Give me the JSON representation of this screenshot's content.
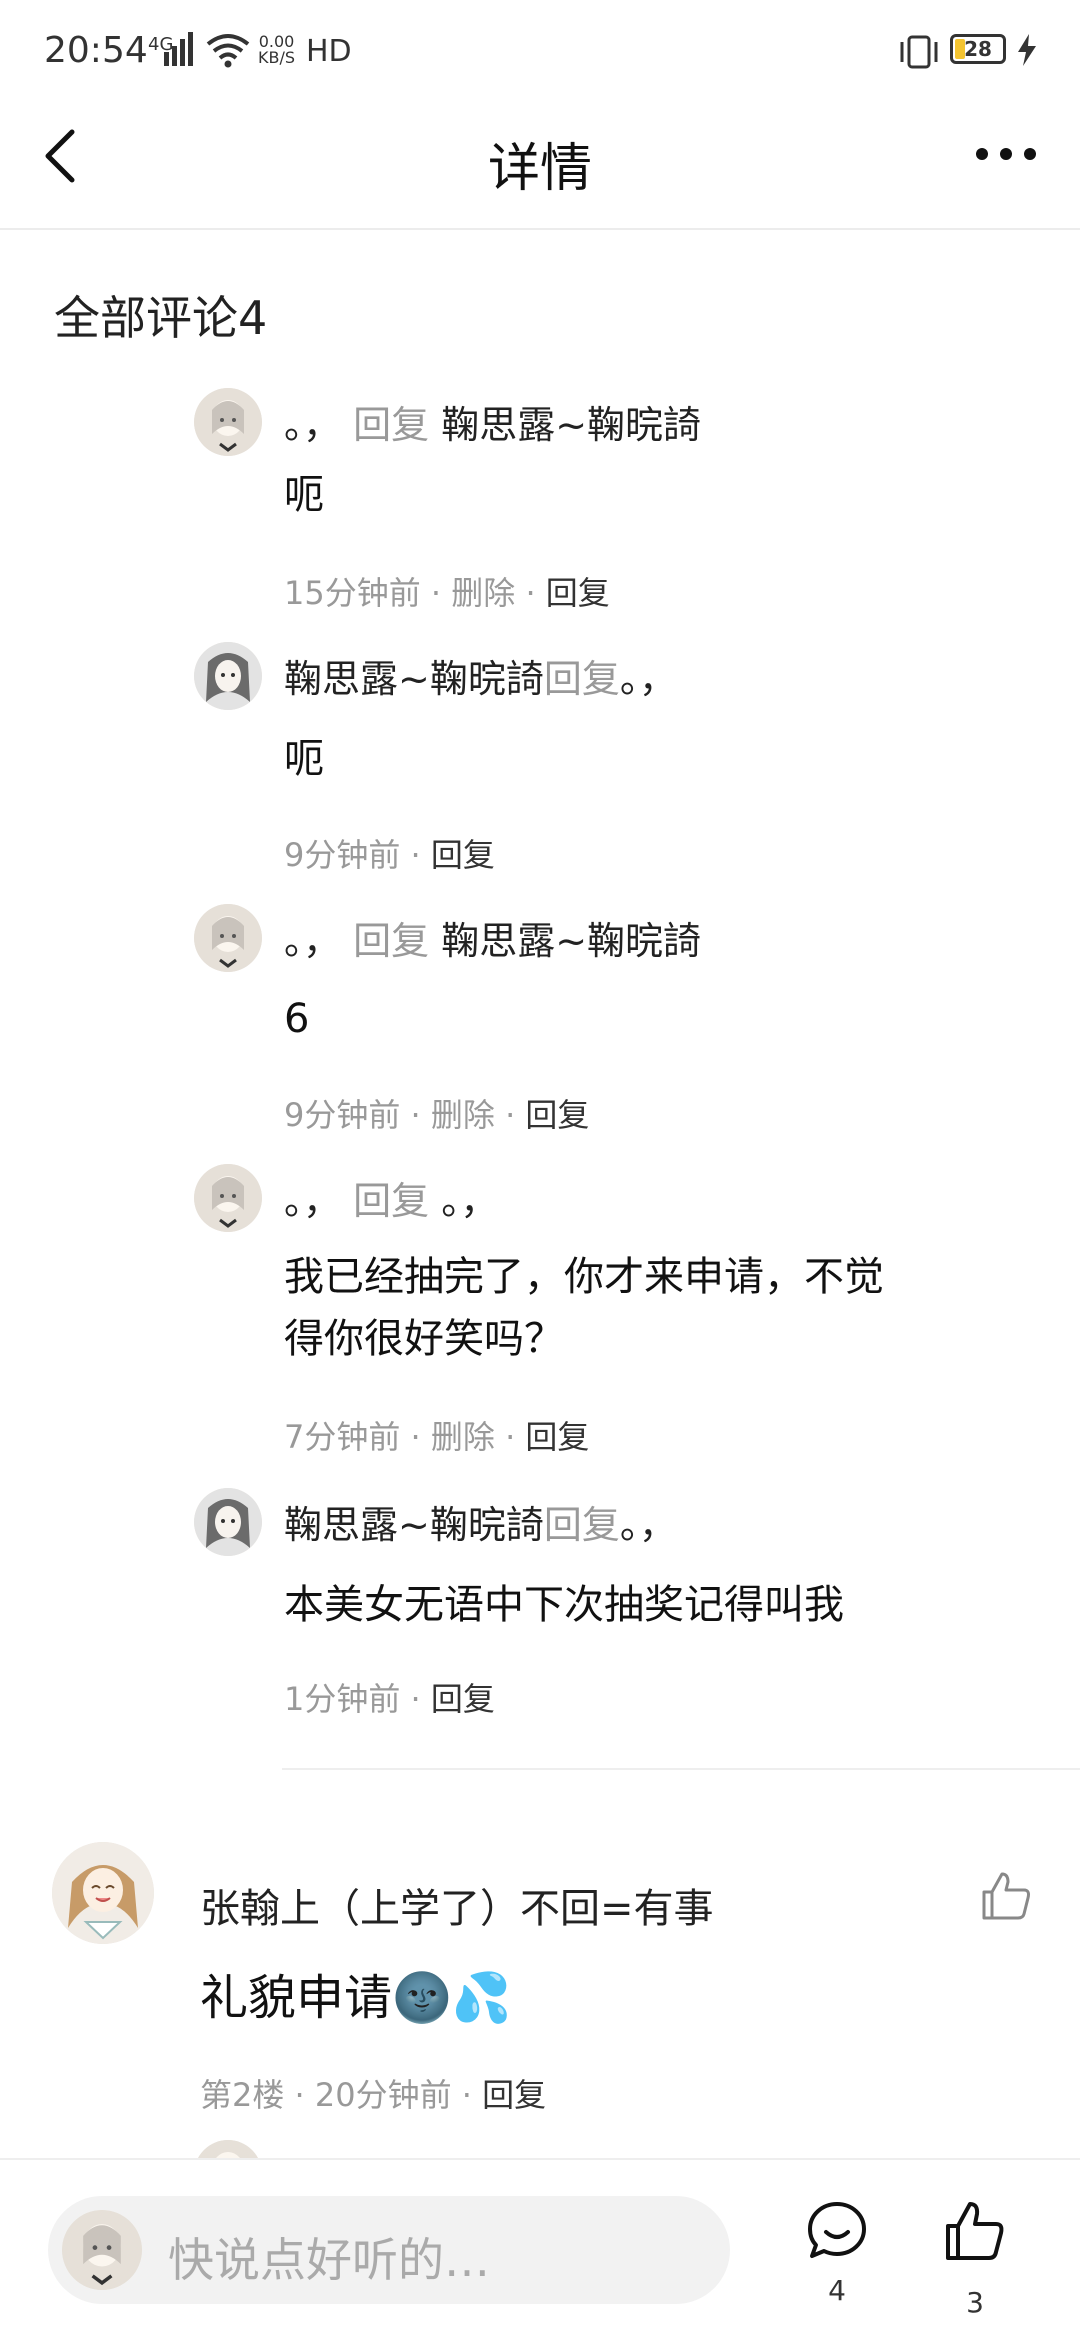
{
  "status_bar": {
    "time": "20:54",
    "network": "4G",
    "speed_value": "0.00",
    "speed_unit": "KB/S",
    "hd": "HD",
    "battery": "28"
  },
  "header": {
    "title": "详情"
  },
  "comments": {
    "section_title": "全部评论4",
    "replies": [
      {
        "author": "。，",
        "reply_word": "回复",
        "target": "鞠思露~鞠晥䛴",
        "text": "呃",
        "time": "15分钟前",
        "delete": "删除",
        "reply": "回复"
      },
      {
        "author": "鞠思露~鞠晥䛴",
        "reply_word": "回复",
        "target": "。，",
        "text": "呃",
        "time": "9分钟前",
        "reply": "回复"
      },
      {
        "author": "。，",
        "reply_word": "回复",
        "target": "鞠思露~鞠晥䛴",
        "text": "6",
        "time": "9分钟前",
        "delete": "删除",
        "reply": "回复"
      },
      {
        "author": "。，",
        "reply_word": "回复",
        "target": "。，",
        "text_line1": "我已经抽完了，你才来申请，不觉",
        "text_line2": "得你很好笑吗？",
        "time": "7分钟前",
        "delete": "删除",
        "reply": "回复"
      },
      {
        "author": "鞠思露~鞠晥䛴",
        "reply_word": "回复",
        "target": "。，",
        "text": "本美女无语中下次抽奖记得叫我",
        "time": "1分钟前",
        "reply": "回复"
      }
    ],
    "floor": {
      "author": "张翰上（上学了）不回=有事",
      "text": "礼貌申请",
      "emoji": "🌚💦",
      "floor_label": "第2楼",
      "time": "20分钟前",
      "reply": "回复"
    }
  },
  "bottom_bar": {
    "placeholder": "快说点好听的…",
    "comment_count": "4",
    "like_count": "3"
  }
}
